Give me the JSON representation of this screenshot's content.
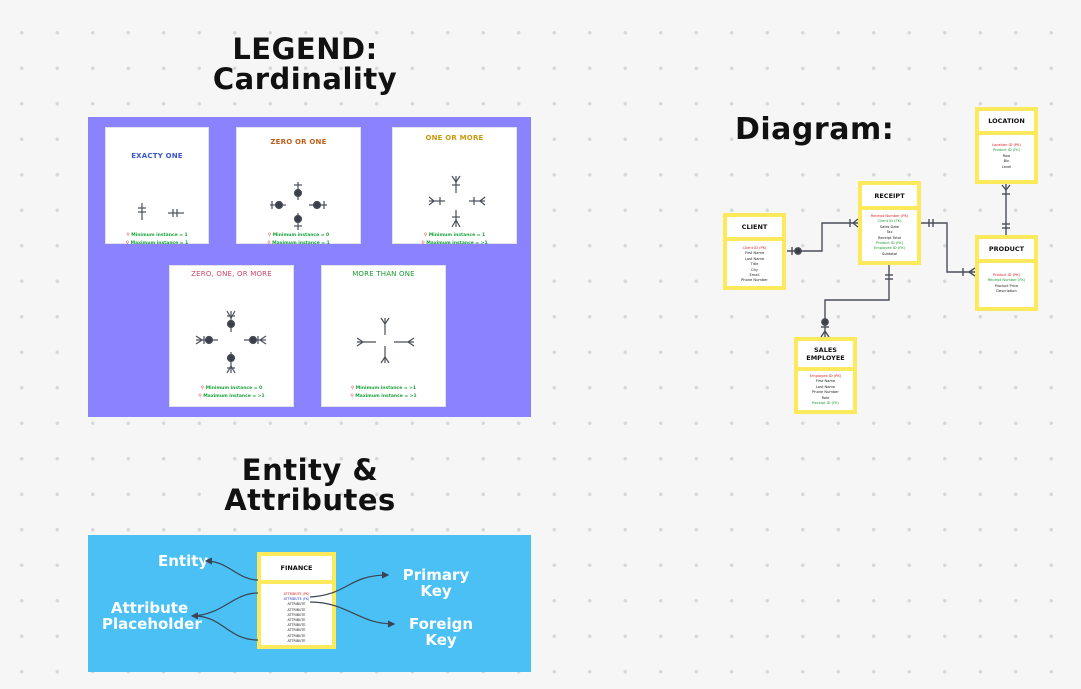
{
  "titles": {
    "legend_line1": "LEGEND:",
    "legend_line2": "Cardinality",
    "entity_line1": "Entity &",
    "entity_line2": "Attributes",
    "diagram": "Diagram:"
  },
  "colors": {
    "legend_panel": "#8b82ff",
    "entity_panel": "#4bc0f5",
    "entity_border": "#fde95c",
    "primary_key": "#e02020",
    "foreign_key": "#1a9a33",
    "connector": "#4a4f5a"
  },
  "cardinality_cards": [
    {
      "title": "EXACTY ONE",
      "title_color": "#3a56c8",
      "min_label": "Minimum instance = 1",
      "max_label": "Maximum instance = 1",
      "notation": "exactly-one"
    },
    {
      "title": "ZERO OR ONE",
      "title_color": "#c0601c",
      "min_label": "Minimum instance = 0",
      "max_label": "Maximum instance = 1",
      "notation": "zero-or-one"
    },
    {
      "title": "ONE OR MORE",
      "title_color": "#c99a10",
      "min_label": "Minimum instance = 1",
      "max_label": "Maximum instance = >1",
      "notation": "one-or-more"
    },
    {
      "title": "ZERO, ONE, OR MORE",
      "title_color": "#d0446a",
      "min_label": "Minimum instance = 0",
      "max_label": "Maximum instance = >1",
      "notation": "zero-one-or-more"
    },
    {
      "title": "MORE THAN ONE",
      "title_color": "#1a9a33",
      "min_label": "Minimum instance = >1",
      "max_label": "Maximum instance = >1",
      "notation": "more-than-one"
    }
  ],
  "entity_attributes_example": {
    "entity_label": "Entity",
    "attribute_label_line1": "Attribute",
    "attribute_label_line2": "Placeholder",
    "primary_key_label": "Primary Key",
    "foreign_key_label": "Foreign Key",
    "entity": {
      "name": "FINANCE",
      "attributes": [
        {
          "text": "ATTRIBUTE (PK)",
          "type": "pk"
        },
        {
          "text": "ATTRIBUTE (FK)",
          "type": "fk-blue"
        },
        {
          "text": "ATTRIBUTE",
          "type": "plain"
        },
        {
          "text": "ATTRIBUTE",
          "type": "plain"
        },
        {
          "text": "ATTRIBUTE",
          "type": "plain"
        },
        {
          "text": "ATTRIBUTE",
          "type": "plain"
        },
        {
          "text": "ATTRIBUTE",
          "type": "plain"
        },
        {
          "text": "ATTRIBUTE",
          "type": "plain"
        },
        {
          "text": "ATTRIBUTE",
          "type": "plain"
        },
        {
          "text": "ATTRIBUTE",
          "type": "plain"
        }
      ]
    }
  },
  "diagram": {
    "entities": {
      "client": {
        "name": "CLIENT",
        "attributes": [
          {
            "text": "Client ID (PK)",
            "type": "pk"
          },
          {
            "text": "First Name",
            "type": "plain"
          },
          {
            "text": "Last Name",
            "type": "plain"
          },
          {
            "text": "Title",
            "type": "plain"
          },
          {
            "text": "City",
            "type": "plain"
          },
          {
            "text": "Email",
            "type": "plain"
          },
          {
            "text": "Phone Number",
            "type": "plain"
          }
        ]
      },
      "receipt": {
        "name": "RECEIPT",
        "attributes": [
          {
            "text": "Receipt Number (PK)",
            "type": "pk"
          },
          {
            "text": "Client ID (FK)",
            "type": "fk"
          },
          {
            "text": "Sales Date",
            "type": "plain"
          },
          {
            "text": "Tax",
            "type": "plain"
          },
          {
            "text": "Receipt Total",
            "type": "plain"
          },
          {
            "text": "Product ID (FK)",
            "type": "fk"
          },
          {
            "text": "Employee ID (FK)",
            "type": "fk"
          },
          {
            "text": "Subtotal",
            "type": "plain"
          }
        ]
      },
      "location": {
        "name": "LOCATION",
        "attributes": [
          {
            "text": "Location ID (PK)",
            "type": "pk"
          },
          {
            "text": "Product ID (FK)",
            "type": "fk"
          },
          {
            "text": "Row",
            "type": "plain"
          },
          {
            "text": "Bin",
            "type": "plain"
          },
          {
            "text": "Level",
            "type": "plain"
          }
        ]
      },
      "product": {
        "name": "PRODUCT",
        "attributes": [
          {
            "text": "Product ID (PK)",
            "type": "pk"
          },
          {
            "text": "Receipt Number (FK)",
            "type": "fk"
          },
          {
            "text": "Product Price",
            "type": "plain"
          },
          {
            "text": "Description",
            "type": "plain"
          }
        ]
      },
      "sales_employee": {
        "name_line1": "SALES",
        "name_line2": "EMPLOYEE",
        "attributes": [
          {
            "text": "Employee ID (PK)",
            "type": "pk"
          },
          {
            "text": "First Name",
            "type": "plain"
          },
          {
            "text": "Last Name",
            "type": "plain"
          },
          {
            "text": "Phone Number",
            "type": "plain"
          },
          {
            "text": "Role",
            "type": "plain"
          },
          {
            "text": "Receipt ID (FK)",
            "type": "fk"
          }
        ]
      }
    },
    "relationships": [
      {
        "from": "client",
        "to": "receipt",
        "from_cardinality": "zero-or-one",
        "to_cardinality": "one-or-more"
      },
      {
        "from": "receipt",
        "to": "product",
        "from_cardinality": "exactly-one",
        "to_cardinality": "one-or-more"
      },
      {
        "from": "location",
        "to": "product",
        "from_cardinality": "one-or-more",
        "to_cardinality": "exactly-one"
      },
      {
        "from": "receipt",
        "to": "sales_employee",
        "from_cardinality": "exactly-one",
        "to_cardinality": "zero-one-or-more"
      }
    ]
  }
}
